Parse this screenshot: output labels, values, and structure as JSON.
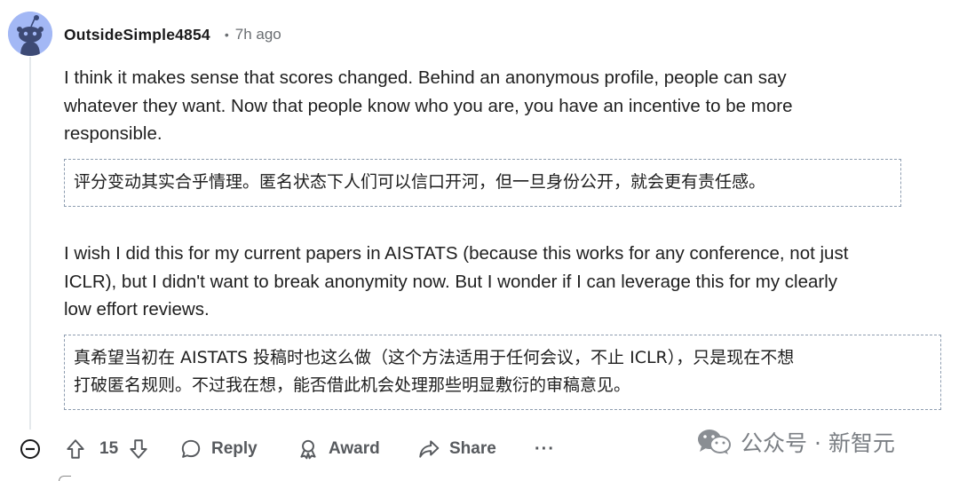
{
  "comment": {
    "author": "OutsideSimple4854",
    "separator": "•",
    "time": "7h ago",
    "paragraph1": [
      "I think it makes sense that scores changed. Behind an anonymous profile, people can say",
      "whatever they want. Now that people know who you are, you have an incentive to be more",
      "responsible."
    ],
    "translation1": [
      "评分变动其实合乎情理。匿名状态下人们可以信口开河，但一旦身份公开，就会更有责任感。"
    ],
    "paragraph2": [
      "I wish I did this for my current papers in AISTATS (because this works for any conference, not just",
      "ICLR), but I didn't want to break anonymity now. But I wonder if I can leverage this for my clearly",
      "low effort reviews."
    ],
    "translation2": [
      "真希望当初在 AISTATS 投稿时也这么做（这个方法适用于任何会议，不止 ICLR），只是现在不想",
      "打破匿名规则。不过我在想，能否借此机会处理那些明显敷衍的审稿意见。"
    ]
  },
  "actions": {
    "vote_count": "15",
    "reply_label": "Reply",
    "award_label": "Award",
    "share_label": "Share",
    "more_label": "···"
  },
  "watermark": {
    "text": "公众号 · 新智元"
  },
  "colors": {
    "avatar_bg": "#a3b8f5",
    "text": "#1f1f1f",
    "muted": "#6a6e72",
    "dashed_border": "#8e9db0"
  },
  "icons": [
    "reddit-snoo-avatar-icon",
    "collapse-icon",
    "upvote-icon",
    "downvote-icon",
    "reply-icon",
    "award-icon",
    "share-icon",
    "wechat-icon"
  ]
}
